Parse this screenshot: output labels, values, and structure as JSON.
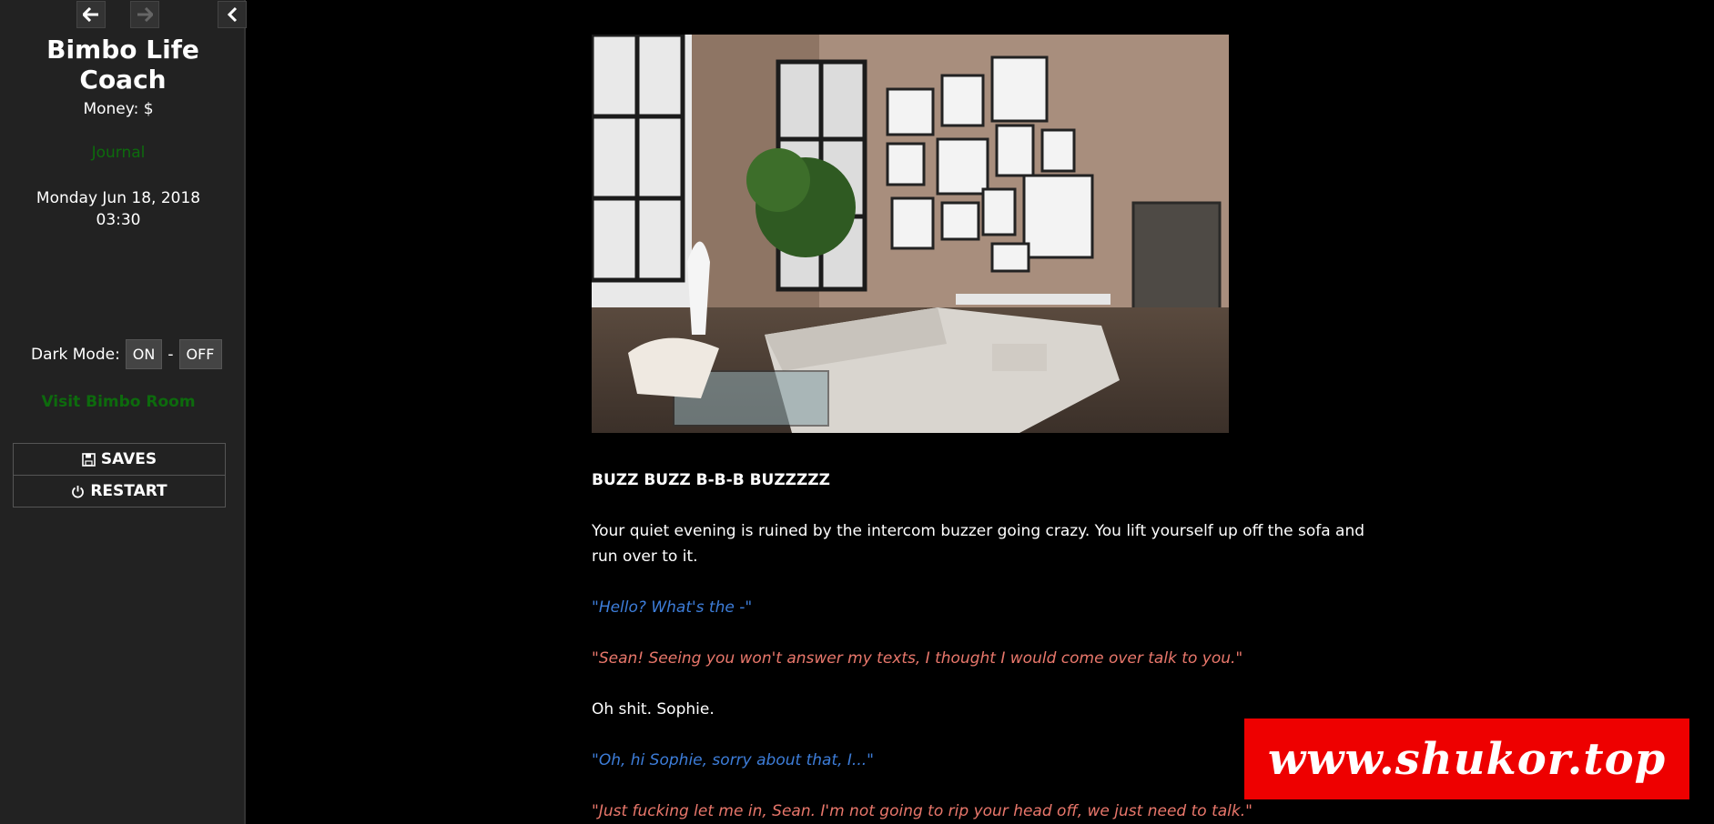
{
  "sidebar": {
    "history_back_icon": "arrow-left-icon",
    "history_forward_icon": "arrow-right-icon",
    "collapse_icon": "chevron-left-icon",
    "title": "Bimbo Life Coach",
    "money": "Money: $",
    "journal": "Journal",
    "date_line1": "Monday Jun 18, 2018",
    "date_line2": "03:30",
    "dark_mode_label": "Dark Mode:",
    "dark_mode_on": "ON",
    "dark_mode_sep": "-",
    "dark_mode_off": "OFF",
    "visit_room": "Visit Bimbo Room",
    "saves": "SAVES",
    "restart": "RESTART"
  },
  "passage": {
    "image_alt": "loft living room with brick walls and gallery wall",
    "heading": "BUZZ BUZZ B-B-B BUZZZZZ",
    "p1": "Your quiet evening is ruined by the intercom buzzer going crazy. You lift yourself up off the sofa and run over to it.",
    "q1": "\"Hello? What's the -\"",
    "q2": "\"Sean! Seeing you won't answer my texts, I thought I would come over talk to you.\"",
    "p2": "Oh shit. Sophie.",
    "q3": "\"Oh, hi Sophie, sorry about that, I...\"",
    "q4": "\"Just fucking let me in, Sean. I'm not going to rip your head off, we just need to talk.\""
  },
  "watermark": "www.shukor.top",
  "colors": {
    "link_green": "#0d6b0d",
    "player_speech": "#3d7dd9",
    "sophie_speech": "#e9776b",
    "watermark_bg": "#e00000"
  }
}
